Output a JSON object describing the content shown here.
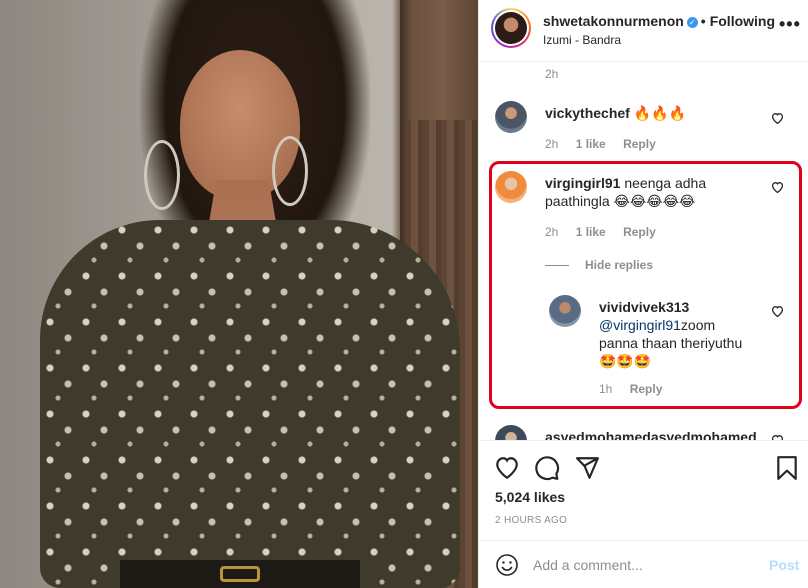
{
  "header": {
    "username": "shwetakonnurmenon",
    "follow_label": "Following",
    "location": "Izumi - Bandra",
    "more_label": "•••"
  },
  "comments": {
    "prev_time": "2h",
    "items": [
      {
        "username": "vickythechef",
        "text": "🔥🔥🔥",
        "time": "2h",
        "likes": "1 like",
        "reply_label": "Reply"
      },
      {
        "username": "virgingirl91",
        "text_line1": "neenga adha",
        "text_line2": "paathingla 😂😂😂😂😂",
        "time": "2h",
        "likes": "1 like",
        "reply_label": "Reply",
        "hide_replies_label": "Hide replies",
        "reply": {
          "username": "vividvivek313",
          "mention": "@virgingirl91",
          "text_line1": "zoom",
          "text_line2": "panna thaan theriyuthu",
          "text_line3": "🤩🤩🤩",
          "time": "1h",
          "reply_label": "Reply"
        }
      },
      {
        "username": "asyedmohamedasyedmohamed"
      }
    ]
  },
  "actions": {
    "likes_count": "5,024 likes",
    "posted_time": "2 HOURS AGO"
  },
  "add_comment": {
    "placeholder": "Add a comment...",
    "post_label": "Post"
  }
}
